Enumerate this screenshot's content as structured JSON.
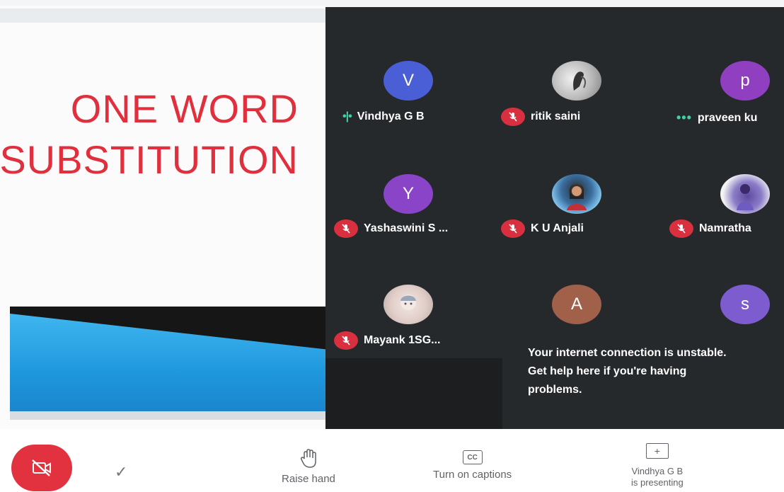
{
  "slide": {
    "title_line1": "ONE WORD",
    "title_line2": "SUBSTITUTION"
  },
  "participants": [
    {
      "name": "Vindhya G B",
      "initial": "V",
      "color": "#4a5fd6",
      "status": "speaking"
    },
    {
      "name": "ritik saini",
      "initial": "",
      "color": "",
      "status": "muted"
    },
    {
      "name": "praveen ku",
      "initial": "p",
      "color": "#8f3fbf",
      "status": "connecting"
    },
    {
      "name": "Yashaswini S ...",
      "initial": "Y",
      "color": "#8a44c8",
      "status": "muted"
    },
    {
      "name": "K U Anjali",
      "initial": "",
      "color": "",
      "status": "muted"
    },
    {
      "name": "Namratha",
      "initial": "",
      "color": "",
      "status": "muted"
    },
    {
      "name": "Mayank 1SG...",
      "initial": "",
      "color": "",
      "status": "muted"
    },
    {
      "name": "",
      "initial": "A",
      "color": "#a0604a",
      "status": ""
    },
    {
      "name": "",
      "initial": "s",
      "color": "#7d5ccf",
      "status": ""
    }
  ],
  "warning": {
    "line1": "Your internet connection is unstable.",
    "line2": "Get help here if you're having",
    "line3": "problems."
  },
  "controls": {
    "raise_hand": "Raise hand",
    "captions": "Turn on captions",
    "presenting_line1": "Vindhya G B",
    "presenting_line2": "is presenting",
    "cc_icon_text": "CC",
    "check_glyph": "✓"
  },
  "icons": [
    "camera-off-icon",
    "check-icon",
    "raise-hand-icon",
    "captions-icon",
    "present-screen-icon",
    "mic-off-icon",
    "speaking-icon"
  ]
}
